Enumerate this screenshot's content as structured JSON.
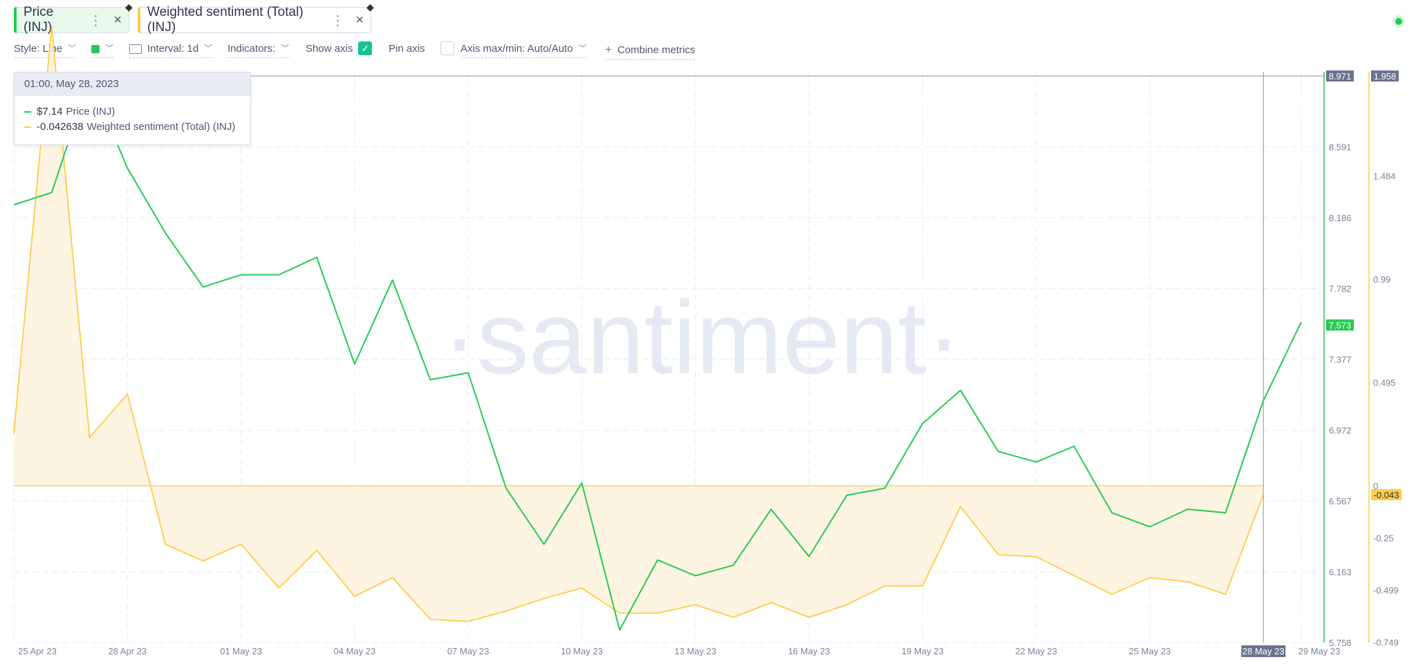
{
  "tabs": [
    {
      "label": "Price (INJ)",
      "color": "#26c953",
      "bg": "#e9f9ee"
    },
    {
      "label": "Weighted sentiment (Total) (INJ)",
      "color": "#ffcb47",
      "bg": "#ffffff"
    }
  ],
  "toolbar": {
    "style_label": "Style: Line",
    "interval_label": "Interval: 1d",
    "indicators_label": "Indicators:",
    "show_axis_label": "Show axis",
    "show_axis_checked": true,
    "pin_axis_label": "Pin axis",
    "pin_axis_checked": false,
    "axis_maxmin_label": "Axis max/min: Auto/Auto",
    "combine_label": "Combine metrics"
  },
  "tooltip": {
    "date": "01:00, May 28, 2023",
    "price_value": "$7.14",
    "price_name": "Price (INJ)",
    "sentiment_value": "-0.042638",
    "sentiment_name": "Weighted sentiment (Total) (INJ)"
  },
  "watermark": "·santiment·",
  "chart_data": {
    "type": "line",
    "x": [
      "25 Apr 23",
      "26 Apr 23",
      "27 Apr 23",
      "28 Apr 23",
      "29 Apr 23",
      "30 Apr 23",
      "01 May 23",
      "02 May 23",
      "03 May 23",
      "04 May 23",
      "05 May 23",
      "06 May 23",
      "07 May 23",
      "08 May 23",
      "09 May 23",
      "10 May 23",
      "11 May 23",
      "12 May 23",
      "13 May 23",
      "14 May 23",
      "15 May 23",
      "16 May 23",
      "17 May 23",
      "18 May 23",
      "19 May 23",
      "20 May 23",
      "21 May 23",
      "22 May 23",
      "23 May 23",
      "24 May 23",
      "25 May 23",
      "26 May 23",
      "27 May 23",
      "28 May 23",
      "29 May 23"
    ],
    "series": [
      {
        "name": "Price (INJ)",
        "color": "#26c953",
        "axis": "left",
        "values": [
          8.26,
          8.33,
          8.98,
          8.47,
          8.1,
          7.79,
          7.86,
          7.86,
          7.96,
          7.35,
          7.83,
          7.26,
          7.3,
          6.64,
          6.32,
          6.67,
          5.83,
          6.23,
          6.14,
          6.2,
          6.52,
          6.25,
          6.6,
          6.64,
          7.01,
          7.2,
          6.85,
          6.79,
          6.88,
          6.5,
          6.42,
          6.52,
          6.5,
          7.14,
          7.59
        ]
      },
      {
        "name": "Weighted sentiment (Total) (INJ)",
        "color": "#ffcb47",
        "axis": "right",
        "values": [
          0.25,
          2.2,
          0.23,
          0.44,
          -0.28,
          -0.36,
          -0.28,
          -0.49,
          -0.31,
          -0.53,
          -0.44,
          -0.64,
          -0.65,
          -0.6,
          -0.54,
          -0.49,
          -0.61,
          -0.61,
          -0.57,
          -0.63,
          -0.56,
          -0.63,
          -0.57,
          -0.48,
          -0.48,
          -0.1,
          -0.33,
          -0.34,
          -0.43,
          -0.52,
          -0.44,
          -0.46,
          -0.52,
          -0.043
        ]
      }
    ],
    "left_axis": {
      "ticks": [
        "8.591",
        "8.186",
        "7.782",
        "7.377",
        "6.972",
        "6.567",
        "6.163",
        "5.758"
      ],
      "ylim": [
        5.758,
        8.996
      ],
      "current": "7.573",
      "max_label": "8.971"
    },
    "right_axis": {
      "ticks": [
        "1.484",
        "0.99",
        "0.495",
        "0",
        "-0.25",
        "-0.499",
        "-0.749"
      ],
      "current": "-0.043",
      "max_label": "1.958"
    },
    "x_ticks": [
      "25 Apr 23",
      "28 Apr 23",
      "01 May 23",
      "04 May 23",
      "07 May 23",
      "10 May 23",
      "13 May 23",
      "16 May 23",
      "19 May 23",
      "22 May 23",
      "25 May 23",
      "28 May 23",
      "29 May 23"
    ],
    "highlight_x": "28 May 23",
    "grid": true,
    "watermark": "santiment"
  }
}
